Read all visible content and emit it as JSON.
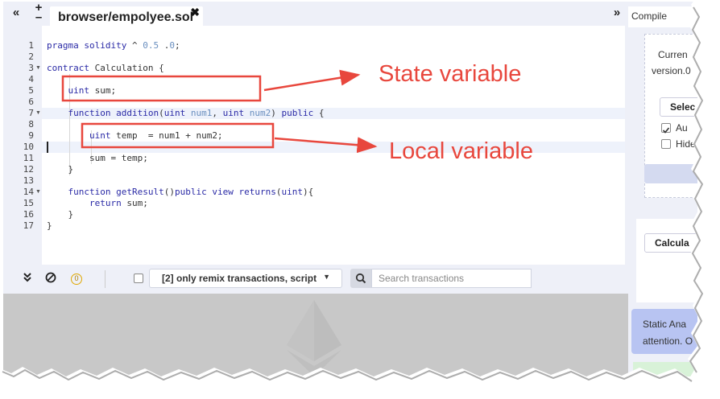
{
  "tabs": {
    "collapse_left": "«",
    "add_tab": "+",
    "remove_tab": "–",
    "active_title": "browser/empolyee.sol",
    "close": "✖",
    "collapse_right": "»"
  },
  "editor": {
    "line_numbers": [
      "1",
      "2",
      "3",
      "4",
      "5",
      "6",
      "7",
      "8",
      "9",
      "10",
      "11",
      "12",
      "13",
      "14",
      "15",
      "16",
      "17"
    ],
    "fold_markers": {
      "3": "▼",
      "7": "▼",
      "14": "▼"
    }
  },
  "annotations": {
    "state": "State variable",
    "local": "Local variable"
  },
  "terminal": {
    "pending_count": "0",
    "filter_label": "[2] only remix transactions, script",
    "search_placeholder": "Search transactions"
  },
  "right_panel": {
    "tab_compile": "Compile",
    "current_version_1": "Curren",
    "current_version_2": "version.0",
    "select_button": "Selec",
    "auto_compile": "Au",
    "hide_warnings": "Hide",
    "contract_select": "Calcula",
    "static_analysis_1": "Static Ana",
    "static_analysis_2": "attention. O"
  },
  "colors": {
    "annotation_red": "#e8473d",
    "keyword": "#2a2aa6",
    "editor_bg": "#ffffff",
    "chrome_bg": "#eef0f8"
  }
}
